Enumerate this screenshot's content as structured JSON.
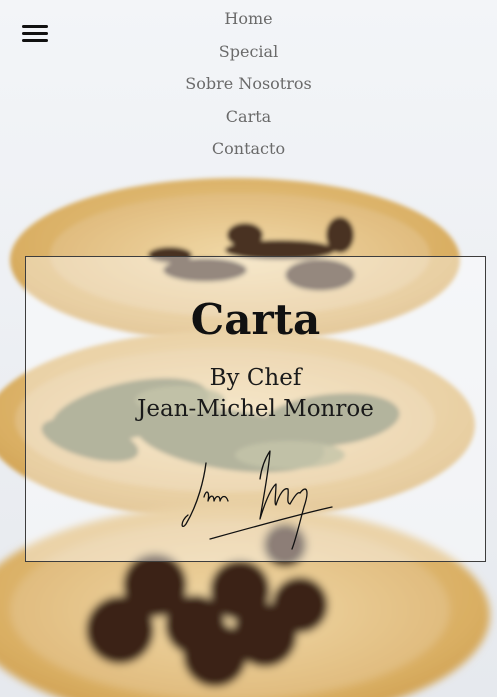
{
  "nav": {
    "menu_icon": "hamburger-icon",
    "items": [
      {
        "label": "Home"
      },
      {
        "label": "Special"
      },
      {
        "label": "Sobre Nosotros"
      },
      {
        "label": "Carta"
      },
      {
        "label": "Contacto"
      }
    ]
  },
  "hero": {
    "title": "Carta",
    "subtitle_line1": "By Chef",
    "subtitle_line2": "Jean-Michel Monroe",
    "signature_text": "Jean Monroe"
  },
  "colors": {
    "nav_text": "#6a6a6a",
    "title_text": "#111111",
    "card_border": "#3d3d3d"
  }
}
